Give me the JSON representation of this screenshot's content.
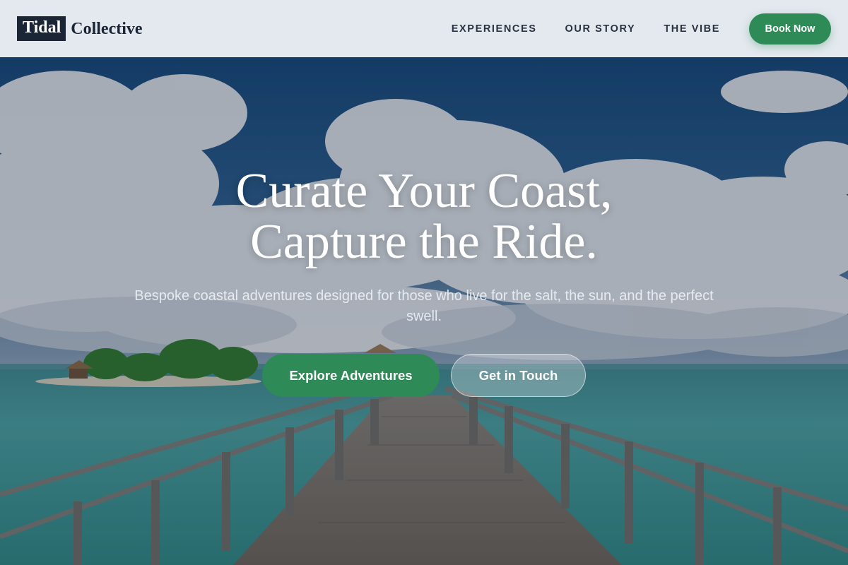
{
  "header": {
    "logo_box_text": "Tidal",
    "logo_rest_text": "Collective",
    "nav": [
      {
        "label": "EXPERIENCES"
      },
      {
        "label": "OUR STORY"
      },
      {
        "label": "THE VIBE"
      }
    ],
    "book_button_label": "Book Now"
  },
  "hero": {
    "title_line1": "Curate Your Coast,",
    "title_line2": "Capture the Ride.",
    "subtitle": "Bespoke coastal adventures designed for those who live for the salt, the sun, and the perfect swell.",
    "primary_cta": "Explore Adventures",
    "secondary_cta": "Get in Touch"
  },
  "colors": {
    "accent": "#2e8b57",
    "logo_dark": "#1b2536",
    "nav_text": "#2a3140",
    "header_bg": "#f1f4f8"
  }
}
